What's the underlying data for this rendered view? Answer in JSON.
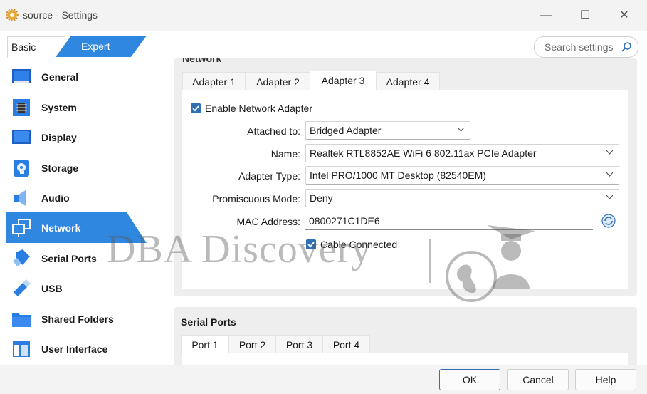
{
  "window": {
    "title": "source - Settings",
    "controls": {
      "minimize": "—",
      "maximize": "☐",
      "close": "✕"
    }
  },
  "mode_tabs": {
    "basic": "Basic",
    "expert": "Expert"
  },
  "search": {
    "placeholder": "Search settings"
  },
  "sidebar": {
    "items": [
      {
        "label": "General",
        "icon": "general-icon"
      },
      {
        "label": "System",
        "icon": "system-chip-icon"
      },
      {
        "label": "Display",
        "icon": "display-monitor-icon"
      },
      {
        "label": "Storage",
        "icon": "storage-disk-icon"
      },
      {
        "label": "Audio",
        "icon": "audio-speaker-icon"
      },
      {
        "label": "Network",
        "icon": "network-icon",
        "selected": true
      },
      {
        "label": "Serial Ports",
        "icon": "serial-ports-icon"
      },
      {
        "label": "USB",
        "icon": "usb-icon"
      },
      {
        "label": "Shared Folders",
        "icon": "shared-folder-icon"
      },
      {
        "label": "User Interface",
        "icon": "user-interface-icon"
      }
    ]
  },
  "network": {
    "section_title": "Network",
    "tabs": [
      "Adapter 1",
      "Adapter 2",
      "Adapter 3",
      "Adapter 4"
    ],
    "active_tab": "Adapter 3",
    "enable_adapter": {
      "label": "Enable Network Adapter",
      "checked": true
    },
    "attached_to": {
      "label": "Attached to:",
      "value": "Bridged Adapter"
    },
    "name": {
      "label": "Name:",
      "value": "Realtek RTL8852AE WiFi 6 802.11ax PCIe Adapter"
    },
    "adapter_type": {
      "label": "Adapter Type:",
      "value": "Intel PRO/1000 MT Desktop (82540EM)"
    },
    "promiscuous": {
      "label": "Promiscuous Mode:",
      "value": "Deny"
    },
    "mac": {
      "label": "MAC Address:",
      "value": "0800271C1DE6"
    },
    "cable_connected": {
      "label": "Cable Connected",
      "checked": true
    }
  },
  "serial_ports": {
    "section_title": "Serial Ports",
    "tabs": [
      "Port 1",
      "Port 2",
      "Port 3",
      "Port 4"
    ],
    "active_tab": "Port 1"
  },
  "buttons": {
    "ok": "OK",
    "cancel": "Cancel",
    "help": "Help"
  },
  "watermark": {
    "text": "DBA Discovery"
  },
  "colors": {
    "accent": "#2f87e0",
    "checkbox": "#2f6fb3",
    "panel": "#eeeeee"
  }
}
